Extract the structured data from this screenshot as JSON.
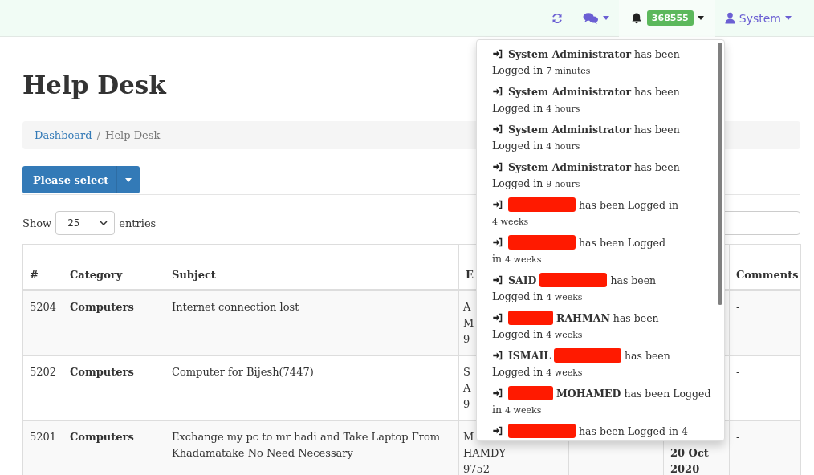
{
  "navbar": {
    "notification_count": "368555",
    "user": "System"
  },
  "page_title": "Help Desk",
  "breadcrumb": {
    "separator": "/",
    "items": [
      {
        "label": "Dashboard",
        "kind": "link"
      },
      {
        "label": "Help Desk",
        "kind": "current"
      }
    ]
  },
  "action_button": {
    "label": "Please select"
  },
  "length_menu": {
    "label_before": "Show",
    "value": "25",
    "label_after": "entries"
  },
  "table": {
    "columns": {
      "number": "#",
      "category": "Category",
      "subject": "Subject",
      "column_4": "E",
      "comments": "Comments"
    },
    "rows": [
      {
        "number": "5204",
        "category": "Computers",
        "subject": "Internet connection lost",
        "column_4": [
          "A",
          "M",
          "9"
        ],
        "comments": "-"
      },
      {
        "number": "5202",
        "category": "Computers",
        "subject": "Computer for Bijesh(7447)",
        "column_4": [
          "S",
          "A",
          "9"
        ],
        "comments": "-"
      },
      {
        "number": "5201",
        "category": "Computers",
        "subject": "Exchange my pc to mr hadi and Take Laptop From Khadamatake No Need Necessary",
        "column_4": [
          "M",
          "HAMDY",
          "9752"
        ],
        "column_6": [
          "20 Oct",
          "2020"
        ],
        "comments": "-"
      }
    ]
  },
  "notifications": [
    {
      "name_before": "System Administrator",
      "redacted": false,
      "text": "has been",
      "continuation": "Logged in",
      "time": "7 minutes"
    },
    {
      "name_before": "System Administrator",
      "redacted": false,
      "text": "has been",
      "continuation": "Logged in",
      "time": "4 hours"
    },
    {
      "name_before": "System Administrator",
      "redacted": false,
      "text": "has been",
      "continuation": "Logged in",
      "time": "4 hours"
    },
    {
      "name_before": "System Administrator",
      "redacted": false,
      "text": "has been",
      "continuation": "Logged in",
      "time": "9 hours"
    },
    {
      "redacted": true,
      "text": "has been Logged in",
      "time": "4 weeks"
    },
    {
      "redacted": true,
      "text": "has been Logged",
      "continuation": "in",
      "time": "4 weeks"
    },
    {
      "name_before": "SAID",
      "redacted": true,
      "text": "has been",
      "continuation": "Logged in",
      "time": "4 weeks"
    },
    {
      "redacted": true,
      "name_after": "RAHMAN",
      "text": "has been",
      "continuation": "Logged in",
      "time": "4 weeks"
    },
    {
      "name_before": "ISMAIL",
      "redacted": true,
      "text": "has been",
      "continuation": "Logged in",
      "time": "4 weeks"
    },
    {
      "redacted": true,
      "name_after": "MOHAMED",
      "text": "has been Logged",
      "continuation": "in",
      "time": "4 weeks"
    },
    {
      "redacted": true,
      "text": "has been Logged in 4"
    }
  ]
}
